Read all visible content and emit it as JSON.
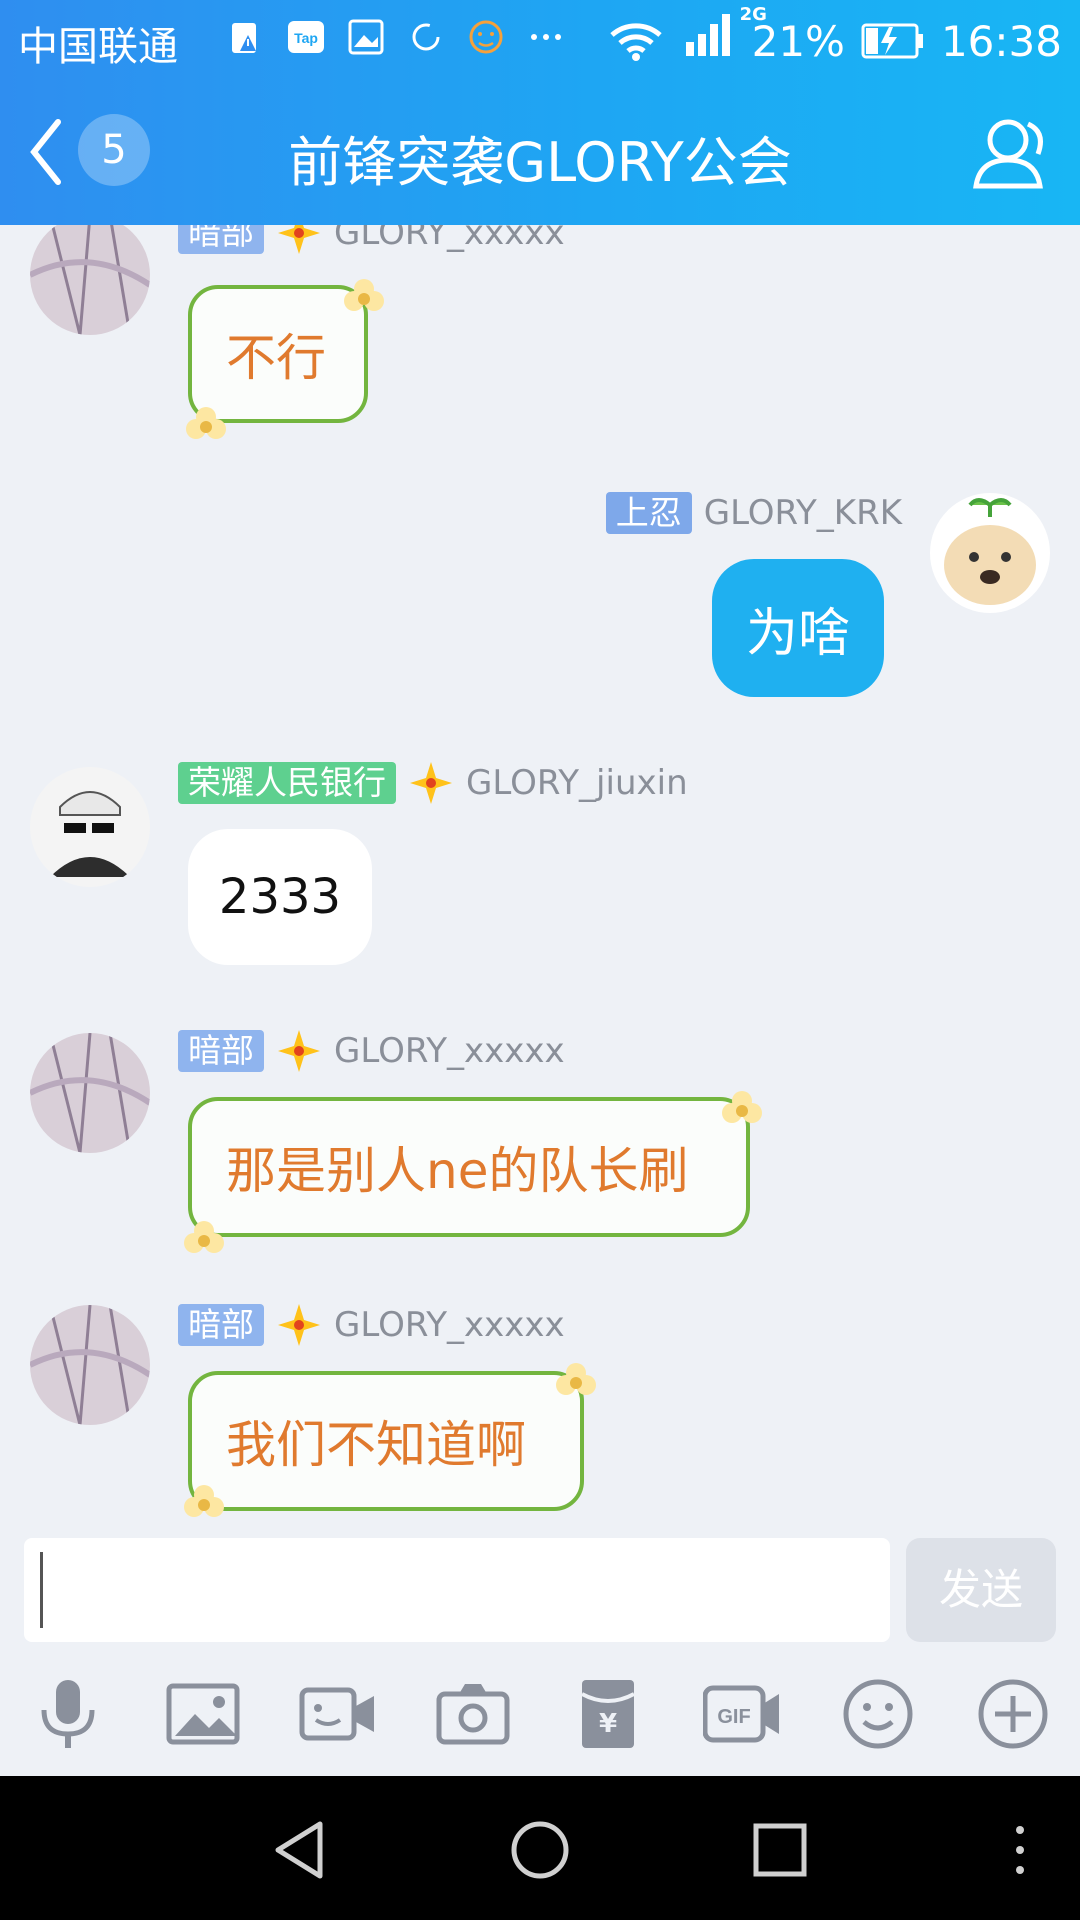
{
  "status_bar": {
    "carrier": "中国联通",
    "network_badge": "2G",
    "battery": "21%",
    "time": "16:38",
    "icons": [
      "storage-warning-icon",
      "tap-app-icon",
      "image-icon",
      "sync-icon",
      "emoji-app-icon",
      "more-dots-icon",
      "wifi-icon",
      "signal-icon",
      "battery-charging-icon"
    ]
  },
  "header": {
    "unread_count": "5",
    "title": "前锋突袭GLORY公会"
  },
  "messages": [
    {
      "role": "暗部",
      "name": "GLORY_xxxxx",
      "text": "不行"
    },
    {
      "role": "上忍",
      "name": "GLORY_KRK",
      "text": "为啥"
    },
    {
      "role": "荣耀人民银行",
      "name": "GLORY_jiuxin",
      "text": "2333"
    },
    {
      "role": "暗部",
      "name": "GLORY_xxxxx",
      "text": "那是别人ne的队长刷"
    },
    {
      "role": "暗部",
      "name": "GLORY_xxxxx",
      "text": "我们不知道啊"
    }
  ],
  "composer": {
    "input_value": "",
    "send_label": "发送"
  },
  "toolbar": [
    "microphone-icon",
    "image-icon",
    "video-call-icon",
    "camera-icon",
    "red-packet-icon",
    "gif-icon",
    "emoji-icon",
    "plus-icon"
  ],
  "colors": {
    "header_gradient_start": "#2f8ef0",
    "header_gradient_end": "#18b6f4",
    "bubble_blue": "#1fb0f0",
    "flower_border": "#73b53f",
    "flower_text": "#e07a2e",
    "chat_bg": "#eef1f6"
  }
}
